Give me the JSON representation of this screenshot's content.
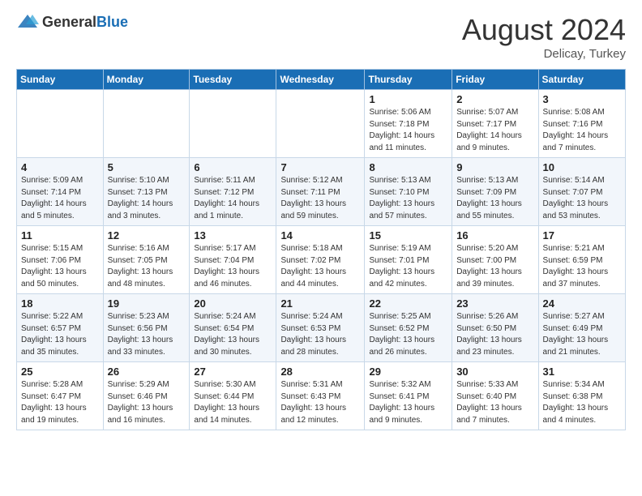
{
  "header": {
    "logo_general": "General",
    "logo_blue": "Blue",
    "month_year": "August 2024",
    "location": "Delicay, Turkey"
  },
  "columns": [
    "Sunday",
    "Monday",
    "Tuesday",
    "Wednesday",
    "Thursday",
    "Friday",
    "Saturday"
  ],
  "weeks": [
    [
      {
        "day": "",
        "info": ""
      },
      {
        "day": "",
        "info": ""
      },
      {
        "day": "",
        "info": ""
      },
      {
        "day": "",
        "info": ""
      },
      {
        "day": "1",
        "info": "Sunrise: 5:06 AM\nSunset: 7:18 PM\nDaylight: 14 hours\nand 11 minutes."
      },
      {
        "day": "2",
        "info": "Sunrise: 5:07 AM\nSunset: 7:17 PM\nDaylight: 14 hours\nand 9 minutes."
      },
      {
        "day": "3",
        "info": "Sunrise: 5:08 AM\nSunset: 7:16 PM\nDaylight: 14 hours\nand 7 minutes."
      }
    ],
    [
      {
        "day": "4",
        "info": "Sunrise: 5:09 AM\nSunset: 7:14 PM\nDaylight: 14 hours\nand 5 minutes."
      },
      {
        "day": "5",
        "info": "Sunrise: 5:10 AM\nSunset: 7:13 PM\nDaylight: 14 hours\nand 3 minutes."
      },
      {
        "day": "6",
        "info": "Sunrise: 5:11 AM\nSunset: 7:12 PM\nDaylight: 14 hours\nand 1 minute."
      },
      {
        "day": "7",
        "info": "Sunrise: 5:12 AM\nSunset: 7:11 PM\nDaylight: 13 hours\nand 59 minutes."
      },
      {
        "day": "8",
        "info": "Sunrise: 5:13 AM\nSunset: 7:10 PM\nDaylight: 13 hours\nand 57 minutes."
      },
      {
        "day": "9",
        "info": "Sunrise: 5:13 AM\nSunset: 7:09 PM\nDaylight: 13 hours\nand 55 minutes."
      },
      {
        "day": "10",
        "info": "Sunrise: 5:14 AM\nSunset: 7:07 PM\nDaylight: 13 hours\nand 53 minutes."
      }
    ],
    [
      {
        "day": "11",
        "info": "Sunrise: 5:15 AM\nSunset: 7:06 PM\nDaylight: 13 hours\nand 50 minutes."
      },
      {
        "day": "12",
        "info": "Sunrise: 5:16 AM\nSunset: 7:05 PM\nDaylight: 13 hours\nand 48 minutes."
      },
      {
        "day": "13",
        "info": "Sunrise: 5:17 AM\nSunset: 7:04 PM\nDaylight: 13 hours\nand 46 minutes."
      },
      {
        "day": "14",
        "info": "Sunrise: 5:18 AM\nSunset: 7:02 PM\nDaylight: 13 hours\nand 44 minutes."
      },
      {
        "day": "15",
        "info": "Sunrise: 5:19 AM\nSunset: 7:01 PM\nDaylight: 13 hours\nand 42 minutes."
      },
      {
        "day": "16",
        "info": "Sunrise: 5:20 AM\nSunset: 7:00 PM\nDaylight: 13 hours\nand 39 minutes."
      },
      {
        "day": "17",
        "info": "Sunrise: 5:21 AM\nSunset: 6:59 PM\nDaylight: 13 hours\nand 37 minutes."
      }
    ],
    [
      {
        "day": "18",
        "info": "Sunrise: 5:22 AM\nSunset: 6:57 PM\nDaylight: 13 hours\nand 35 minutes."
      },
      {
        "day": "19",
        "info": "Sunrise: 5:23 AM\nSunset: 6:56 PM\nDaylight: 13 hours\nand 33 minutes."
      },
      {
        "day": "20",
        "info": "Sunrise: 5:24 AM\nSunset: 6:54 PM\nDaylight: 13 hours\nand 30 minutes."
      },
      {
        "day": "21",
        "info": "Sunrise: 5:24 AM\nSunset: 6:53 PM\nDaylight: 13 hours\nand 28 minutes."
      },
      {
        "day": "22",
        "info": "Sunrise: 5:25 AM\nSunset: 6:52 PM\nDaylight: 13 hours\nand 26 minutes."
      },
      {
        "day": "23",
        "info": "Sunrise: 5:26 AM\nSunset: 6:50 PM\nDaylight: 13 hours\nand 23 minutes."
      },
      {
        "day": "24",
        "info": "Sunrise: 5:27 AM\nSunset: 6:49 PM\nDaylight: 13 hours\nand 21 minutes."
      }
    ],
    [
      {
        "day": "25",
        "info": "Sunrise: 5:28 AM\nSunset: 6:47 PM\nDaylight: 13 hours\nand 19 minutes."
      },
      {
        "day": "26",
        "info": "Sunrise: 5:29 AM\nSunset: 6:46 PM\nDaylight: 13 hours\nand 16 minutes."
      },
      {
        "day": "27",
        "info": "Sunrise: 5:30 AM\nSunset: 6:44 PM\nDaylight: 13 hours\nand 14 minutes."
      },
      {
        "day": "28",
        "info": "Sunrise: 5:31 AM\nSunset: 6:43 PM\nDaylight: 13 hours\nand 12 minutes."
      },
      {
        "day": "29",
        "info": "Sunrise: 5:32 AM\nSunset: 6:41 PM\nDaylight: 13 hours\nand 9 minutes."
      },
      {
        "day": "30",
        "info": "Sunrise: 5:33 AM\nSunset: 6:40 PM\nDaylight: 13 hours\nand 7 minutes."
      },
      {
        "day": "31",
        "info": "Sunrise: 5:34 AM\nSunset: 6:38 PM\nDaylight: 13 hours\nand 4 minutes."
      }
    ]
  ]
}
